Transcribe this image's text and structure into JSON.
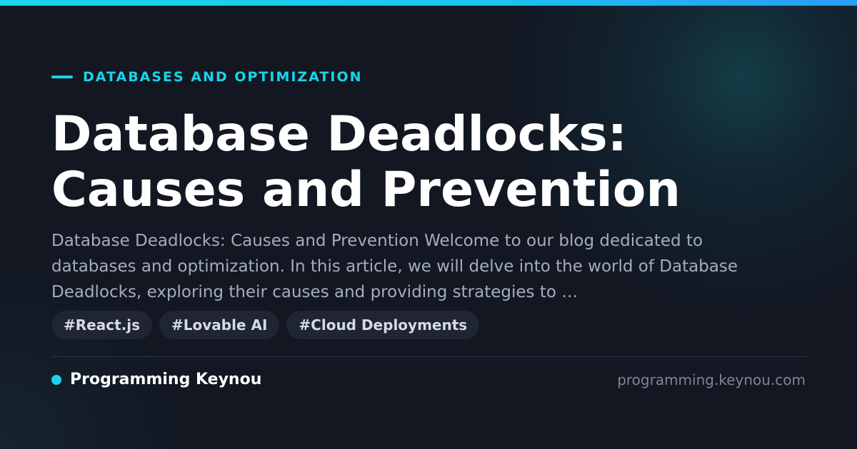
{
  "category": {
    "label": "DATABASES AND OPTIMIZATION"
  },
  "article": {
    "title": "Database Deadlocks: Causes and Prevention",
    "excerpt": "Database Deadlocks: Causes and Prevention Welcome to our blog dedicated to databases and optimization. In this article, we will delve into the world of Database Deadlocks, exploring their causes and providing strategies to …"
  },
  "tags": [
    "#React.js",
    "#Lovable AI",
    "#Cloud Deployments"
  ],
  "footer": {
    "brand": "Programming Keynou",
    "domain": "programming.keynou.com"
  },
  "colors": {
    "accent": "#19d4ea",
    "background": "#121722",
    "title": "#ffffff",
    "excerpt": "#a4adbd",
    "tag_background": "#1f2532",
    "domain_text": "#7d8595"
  }
}
